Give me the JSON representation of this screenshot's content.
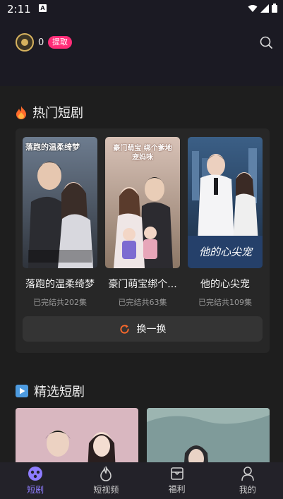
{
  "status": {
    "time": "2:11",
    "a_icon": "A"
  },
  "header": {
    "coin_count": "0",
    "withdraw_label": "提取"
  },
  "hot_section": {
    "title": "热门短剧",
    "items": [
      {
        "name": "落跑的温柔绮梦",
        "status": "已完结共202集",
        "poster_text": "落跑的温柔绮梦"
      },
      {
        "name": "豪门萌宝绑个...",
        "status": "已完结共63集",
        "poster_text": "豪门萌宝 绑个爹地宠妈咪"
      },
      {
        "name": "他的心尖宠",
        "status": "已完结共109集",
        "poster_text": "他的心尖宠"
      }
    ],
    "refresh_label": "换一换"
  },
  "featured_section": {
    "title": "精选短剧"
  },
  "tabs": [
    {
      "label": "短剧",
      "icon": "drama-icon",
      "active": true
    },
    {
      "label": "短视频",
      "icon": "flame-icon",
      "active": false
    },
    {
      "label": "福利",
      "icon": "gift-icon",
      "active": false
    },
    {
      "label": "我的",
      "icon": "profile-icon",
      "active": false
    }
  ],
  "colors": {
    "accent": "#8e7cff",
    "withdraw": "#ff2d78",
    "fire": "#ff6a2b",
    "refresh_icon": "#ff6a2b"
  }
}
